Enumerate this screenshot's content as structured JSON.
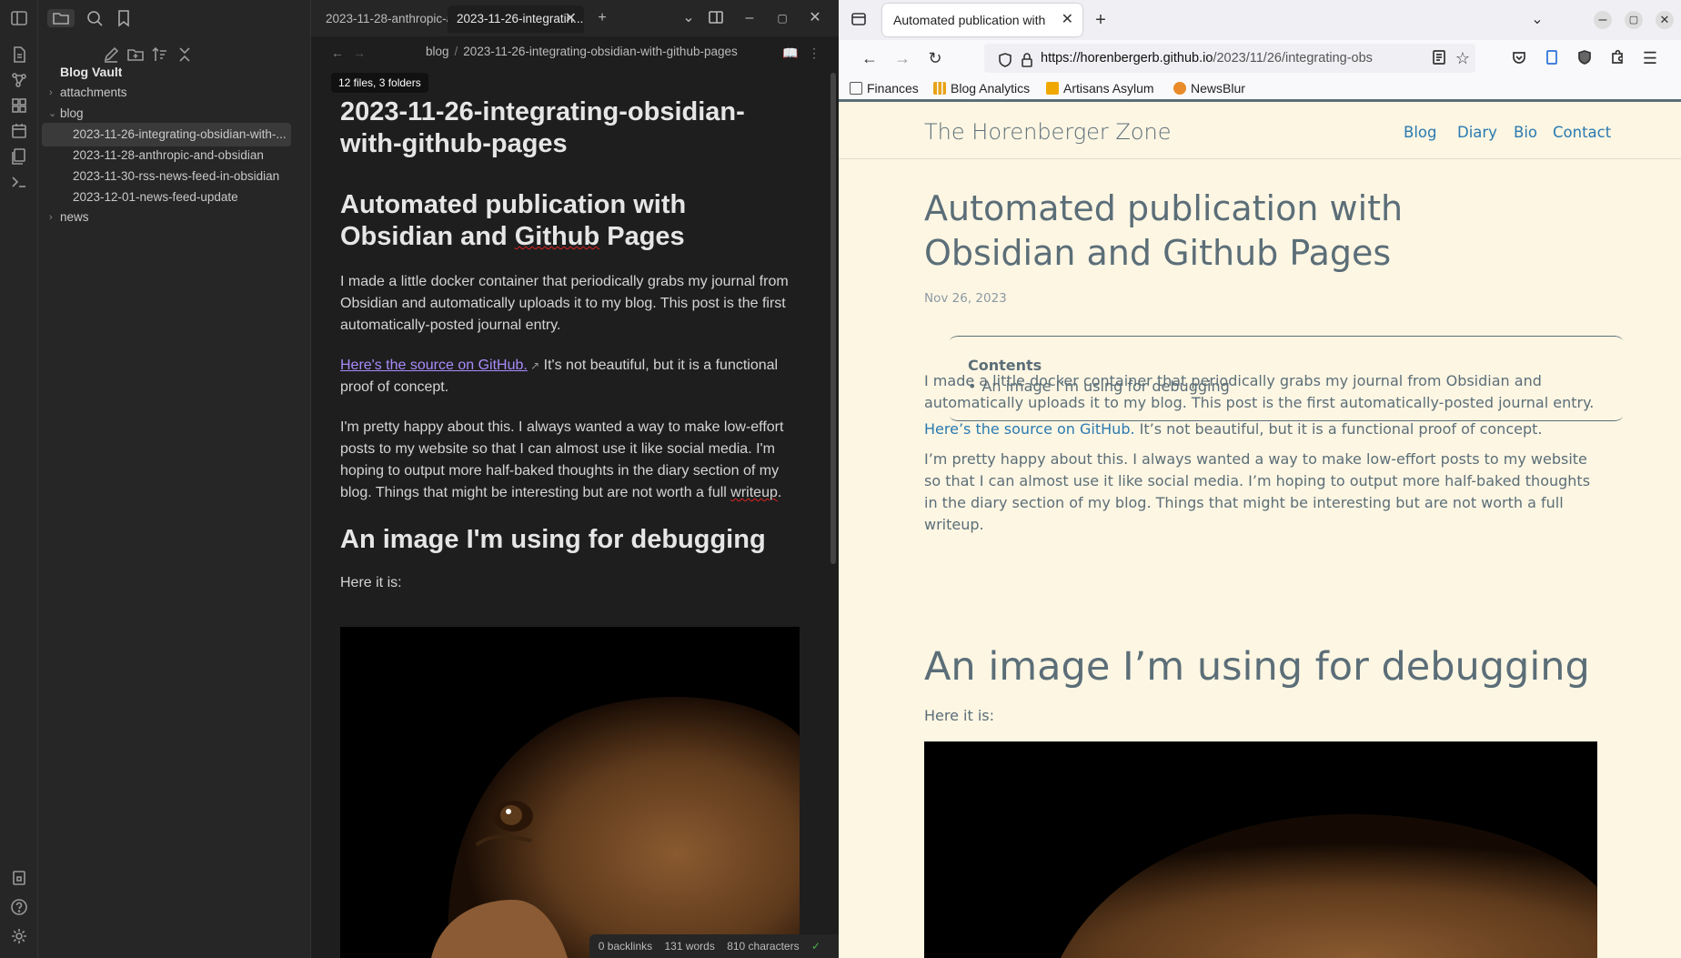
{
  "obsidian": {
    "tabs": [
      {
        "label": "2023-11-28-anthropic-an..."
      },
      {
        "label": "2023-11-26-integratin...",
        "active": true
      }
    ],
    "breadcrumb": {
      "folder": "blog",
      "file": "2023-11-26-integrating-obsidian-with-github-pages"
    },
    "tooltip": "12 files, 3 folders",
    "vault_name": "Blog Vault",
    "tree": [
      {
        "label": "attachments",
        "type": "folder",
        "expanded": false
      },
      {
        "label": "blog",
        "type": "folder",
        "expanded": true
      },
      {
        "label": "2023-11-26-integrating-obsidian-with-...",
        "type": "file",
        "selected": true
      },
      {
        "label": "2023-11-28-anthropic-and-obsidian",
        "type": "file"
      },
      {
        "label": "2023-11-30-rss-news-feed-in-obsidian",
        "type": "file"
      },
      {
        "label": "2023-12-01-news-feed-update",
        "type": "file"
      },
      {
        "label": "news",
        "type": "folder",
        "expanded": false
      }
    ],
    "note": {
      "title": "2023-11-26-integrating-obsidian-with-github-pages",
      "h1_part1": "Automated publication with Obsidian and ",
      "h1_github": "Github",
      "h1_part2": " Pages",
      "p1": "I made a little docker container that periodically grabs my journal from Obsidian and automatically uploads it to my blog. This post is the first automatically-posted journal entry.",
      "p2_link": "Here's the source on GitHub.",
      "p2_rest": " It's not beautiful, but it is a functional proof of concept.",
      "p3_part1": "I'm pretty happy about this. I always wanted a way to make low-effort posts to my website so that I can almost use it like social media. I'm hoping to output more half-baked thoughts in the diary section of my blog. Things that might be interesting but are not worth a full ",
      "p3_writeup": "writeup",
      "p3_end": ".",
      "h2": "An image I'm using for debugging",
      "p4": "Here it is:"
    },
    "status": {
      "backlinks": "0 backlinks",
      "words": "131 words",
      "chars": "810 characters"
    }
  },
  "firefox": {
    "tab_title": "Automated publication with",
    "url_host": "https://horenbergerb.github.io",
    "url_path": "/2023/11/26/integrating-obs",
    "bookmarks": [
      {
        "label": "Finances",
        "color": "#555"
      },
      {
        "label": "Blog Analytics",
        "color": "#e8a317"
      },
      {
        "label": "Artisans Asylum",
        "color": "#f0a800"
      },
      {
        "label": "NewsBlur",
        "color": "#e98b2a"
      }
    ],
    "page": {
      "site_title": "The Horenberger Zone",
      "nav": [
        "Blog",
        "Diary",
        "Bio",
        "Contact"
      ],
      "title": "Automated publication with Obsidian and Github Pages",
      "date": "Nov 26, 2023",
      "toc_title": "Contents",
      "toc_item": "An image I’m using for debugging",
      "p1": "I made a little docker container that periodically grabs my journal from Obsidian and automatically uploads it to my blog. This post is the first automatically-posted journal entry.",
      "p2_link": "Here’s the source on GitHub.",
      "p2_rest": " It’s not beautiful, but it is a functional proof of concept.",
      "p3": "I’m pretty happy about this. I always wanted a way to make low-effort posts to my website so that I can almost use it like social media. I’m hoping to output more half-baked thoughts in the diary section of my blog. Things that might be interesting but are not worth a full writeup.",
      "h2": "An image I’m using for debugging",
      "p4": "Here it is:"
    }
  },
  "colors": {
    "link_obsidian": "#a88bfa",
    "link_blog": "#2a7ab0",
    "blog_bg": "#fdf6e3",
    "blog_text": "#5b6e78"
  }
}
